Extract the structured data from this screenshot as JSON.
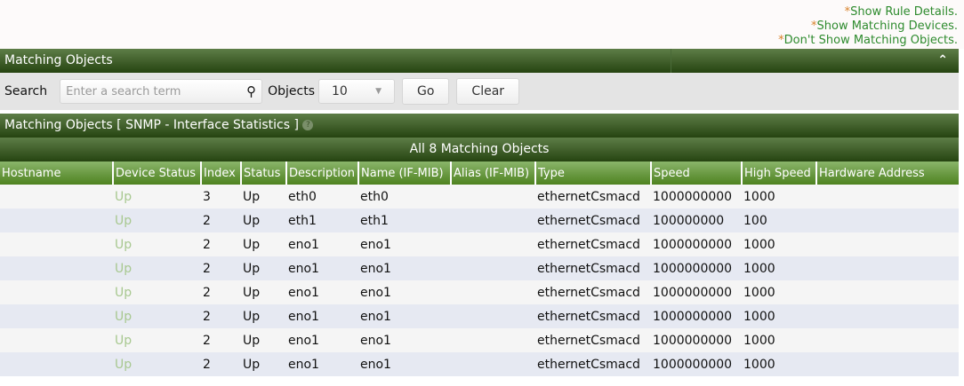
{
  "links": [
    "Show Rule Details.",
    "Show Matching Devices.",
    "Don't Show Matching Objects."
  ],
  "panel_title": "Matching Objects",
  "search": {
    "label": "Search",
    "placeholder": "Enter a search term",
    "objects_label": "Objects",
    "objects_value": "10",
    "go": "Go",
    "clear": "Clear"
  },
  "table_title": "Matching Objects [ SNMP - Interface Statistics ]",
  "help": "?",
  "summary": "All 8 Matching Objects",
  "columns": [
    "Hostname",
    "Device Status",
    "Index",
    "Status",
    "Description",
    "Name (IF-MIB)",
    "Alias (IF-MIB)",
    "Type",
    "Speed",
    "High Speed",
    "Hardware Address"
  ],
  "rows": [
    [
      "",
      "Up",
      "3",
      "Up",
      "eth0",
      "eth0",
      "",
      "ethernetCsmacd",
      "1000000000",
      "1000",
      ""
    ],
    [
      "",
      "Up",
      "2",
      "Up",
      "eth1",
      "eth1",
      "",
      "ethernetCsmacd",
      "100000000",
      "100",
      ""
    ],
    [
      "",
      "Up",
      "2",
      "Up",
      "eno1",
      "eno1",
      "",
      "ethernetCsmacd",
      "1000000000",
      "1000",
      ""
    ],
    [
      "",
      "Up",
      "2",
      "Up",
      "eno1",
      "eno1",
      "",
      "ethernetCsmacd",
      "1000000000",
      "1000",
      ""
    ],
    [
      "",
      "Up",
      "2",
      "Up",
      "eno1",
      "eno1",
      "",
      "ethernetCsmacd",
      "1000000000",
      "1000",
      ""
    ],
    [
      "",
      "Up",
      "2",
      "Up",
      "eno1",
      "eno1",
      "",
      "ethernetCsmacd",
      "1000000000",
      "1000",
      ""
    ],
    [
      "",
      "Up",
      "2",
      "Up",
      "eno1",
      "eno1",
      "",
      "ethernetCsmacd",
      "1000000000",
      "1000",
      ""
    ],
    [
      "",
      "Up",
      "2",
      "Up",
      "eno1",
      "eno1",
      "",
      "ethernetCsmacd",
      "1000000000",
      "1000",
      ""
    ]
  ]
}
